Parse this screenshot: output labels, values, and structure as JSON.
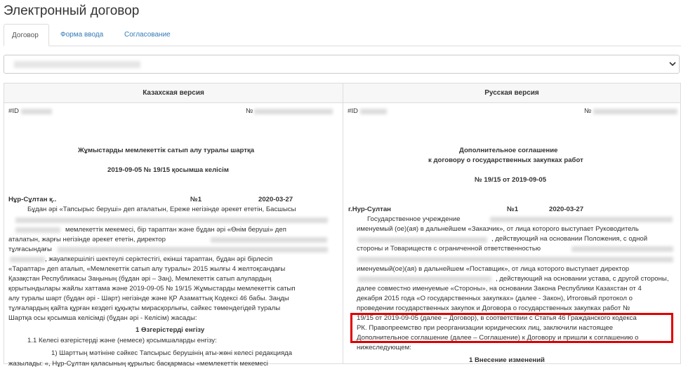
{
  "page": {
    "title": "Электронный договор"
  },
  "tabs": [
    {
      "label": "Договор"
    },
    {
      "label": "Форма ввода"
    },
    {
      "label": "Согласование"
    }
  ],
  "left": {
    "header": "Казахская версия",
    "id_label": "#ID",
    "num_label": "№",
    "title1": "Жұмыстарды мемлекеттік сатып алу туралы шартқа",
    "title2": "2019-09-05 № 19/15 қосымша келісім",
    "city": "Нұр-Сұлтан қ..",
    "no": "№1",
    "date": "2020-03-27",
    "l1": "Бұдан әрі «Тапсырыс беруші» деп аталатын, Ереже негізінде әрекет ететін, Басшысы",
    "l3": "мемлекеттік мекемесі, бір тараптан және бұдан әрі «Өнім беруші» деп",
    "l4": "аталатын, жарғы негізінде әрекет ететін, директор",
    "l5": "тұлғасындағы",
    "l6": ", жауапкершілігі шектеулі серіктестігі, екінші тараптан, бұдан әрі бірлесіп",
    "l7": "«Тараптар» деп аталып, «Мемлекеттік сатып алу туралы» 2015 жылғы 4 желтоқсандағы",
    "l8": "Қазақстан Республикасы Заңының (бұдан әрі – Заң), Мемлекеттік сатып алулардың",
    "l9": "қорытындылары жайлы хаттама және 2019-09-05 № 19/15 Жұмыстарды мемлекеттік сатып",
    "l10": "алу туралы шарт (бұдан әрі - Шарт) негізінде және ҚР Азаматтық Кодексі 46 бабы. Заңды",
    "l11": "тұлғалардың қайта құрған кездегі құқықты мирасқорлығы, сәйкес төмендегідей туралы",
    "l12": "Шартқа осы қосымша келісімді (бұдан әрі - Келісім) жасады:",
    "sec1": "1 Өзгерістерді енгізу",
    "s11": "1.1 Келесі өзгерістерді және (немесе) қосымшаларды енгізу:",
    "s12": "1) Шарттың мәтініне сәйкес Тапсырыс берушінің аты-жөні келесі редакцияда",
    "s13": "жазылады: «, Нұр-Сұлтан қаласының құрылыс басқармасы «мемлекеттік мекемесі"
  },
  "right": {
    "header": "Русская версия",
    "id_label": "#ID",
    "num_label": "№",
    "title1": "Дополнительное соглашение",
    "title2": "к договору о государственных закупках работ",
    "title3": "№ 19/15 от 2019-09-05",
    "city": "г.Нур-Султан",
    "no": "№1",
    "date": "2020-03-27",
    "r1": "Государственное учреждение",
    "r2": "именуемый (ое)(ая) в дальнейшем «Заказчик», от лица которого выступает Руководитель",
    "r3": ", действующий на основании Положения, с одной",
    "r4": "стороны и Товариществ с ограниченной ответственностью",
    "r6": "именуемый(ое)(ая) в дальнейшем «Поставщик», от лица которого выступает директор",
    "r7": ", действующий на основании устава, с другой стороны,",
    "r8": "далее совместно именуемые «Стороны», на основании Закона Республики Казахстан от 4",
    "r9": "декабря 2015 года «О государственных закупках» (далее - Закон), Итоговый протокол о",
    "r10": "проведении государственных закупок и Договора о государственных закупках работ №",
    "r11": "19/15 от 2019-09-05 (далее – Договор), в соответствии с Статья 46 Гражданского кодекса",
    "r12": "РК. Правопреемство при реорганизации юридических лиц, заключили настоящее",
    "r13": "Дополнительное соглашение (далее – Соглашение) к Договору и пришли к соглашению о",
    "r14": "нижеследующем:",
    "sec1": "1 Внесение изменений"
  }
}
